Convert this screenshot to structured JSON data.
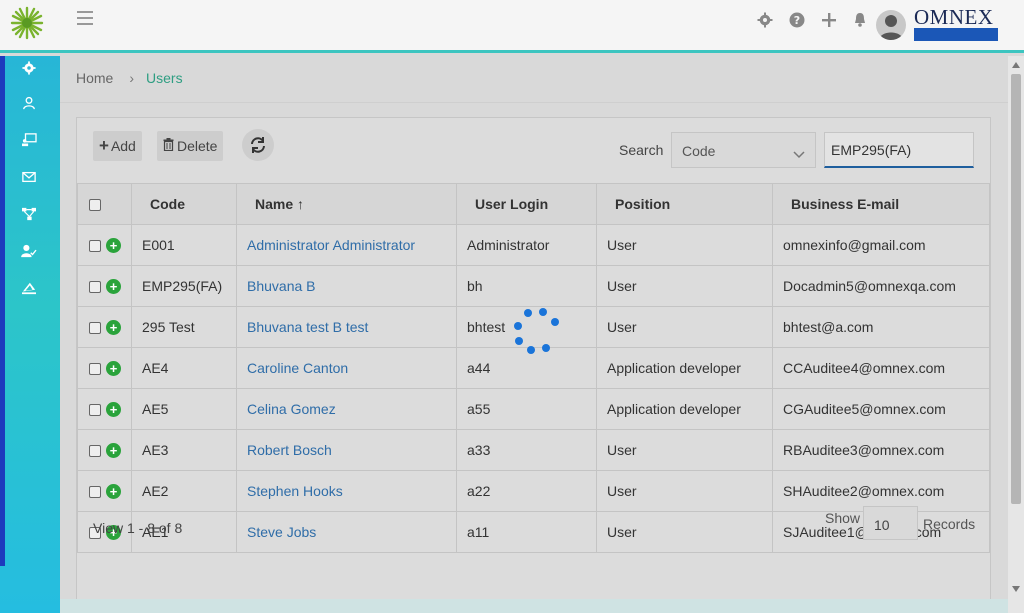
{
  "header": {
    "brand": "OMNEX",
    "icons": [
      "settings-icon",
      "help-icon",
      "plus-icon",
      "bell-icon",
      "avatar"
    ]
  },
  "sidebar": {
    "items": [
      "gear-icon",
      "user-icon",
      "chalkboard-icon",
      "mail-icon",
      "org-tree-icon",
      "user-check-icon",
      "signature-icon"
    ]
  },
  "breadcrumb": {
    "home": "Home",
    "sep": "›",
    "current": "Users"
  },
  "toolbar": {
    "add_label": "Add",
    "delete_label": "Delete",
    "search_label": "Search",
    "search_field": "Code",
    "search_value": "EMP295(FA)"
  },
  "table": {
    "headers": [
      "Code",
      "Name ↑",
      "User Login",
      "Position",
      "Business E-mail"
    ],
    "rows": [
      {
        "code": "E001",
        "name": "Administrator Administrator",
        "login": "Administrator",
        "position": "User",
        "email": "omnexinfo@gmail.com"
      },
      {
        "code": "EMP295(FA)",
        "name": "Bhuvana B",
        "login": "bh",
        "position": "User",
        "email": "Docadmin5@omnexqa.com"
      },
      {
        "code": "295 Test",
        "name": "Bhuvana test B test",
        "login": "bhtest",
        "position": "User",
        "email": "bhtest@a.com"
      },
      {
        "code": "AE4",
        "name": "Caroline Canton",
        "login": "a44",
        "position": "Application developer",
        "email": "CCAuditee4@omnex.com"
      },
      {
        "code": "AE5",
        "name": "Celina Gomez",
        "login": "a55",
        "position": "Application developer",
        "email": "CGAuditee5@omnex.com"
      },
      {
        "code": "AE3",
        "name": "Robert Bosch",
        "login": "a33",
        "position": "User",
        "email": "RBAuditee3@omnex.com"
      },
      {
        "code": "AE2",
        "name": "Stephen Hooks",
        "login": "a22",
        "position": "User",
        "email": "SHAuditee2@omnex.com"
      },
      {
        "code": "AE1",
        "name": "Steve Jobs",
        "login": "a11",
        "position": "User",
        "email": "SJAuditee1@omnex.com"
      }
    ]
  },
  "footer": {
    "view_text": "View 1 - 8 of 8",
    "show_label": "Show",
    "page_size": "10",
    "records_label": "Records"
  },
  "colors": {
    "accent": "#3cc5c0",
    "link": "#2f6da8",
    "success": "#2aa33b",
    "brand": "#1b2a56"
  }
}
